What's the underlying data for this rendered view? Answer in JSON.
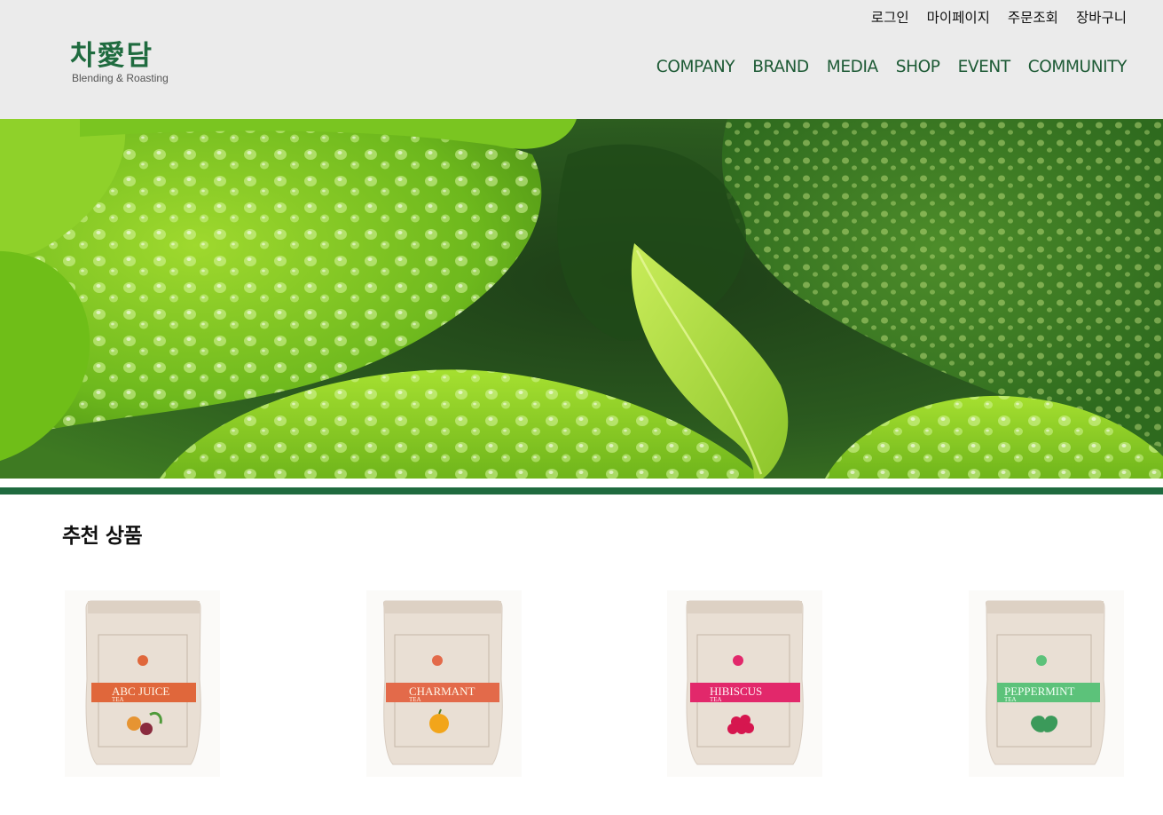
{
  "header": {
    "logo": {
      "mark": "차愛담",
      "sub": "Blending & Roasting"
    },
    "util_nav": [
      "로그인",
      "마이페이지",
      "주문조회",
      "장바구니"
    ],
    "main_nav": [
      "COMPANY",
      "BRAND",
      "MEDIA",
      "SHOP",
      "EVENT",
      "COMMUNITY"
    ]
  },
  "hero": {
    "image": "green-leaves-with-water-droplets"
  },
  "section": {
    "title": "추천 상품"
  },
  "products": [
    {
      "name": "ABC JUICE",
      "sub": "TEA",
      "accent": "#e0673b",
      "illustration": "vegetables"
    },
    {
      "name": "CHARMANT",
      "sub": "TEA",
      "accent": "#e36a4a",
      "illustration": "orange-fruit"
    },
    {
      "name": "HIBISCUS",
      "sub": "TEA",
      "accent": "#e2286b",
      "illustration": "hibiscus-flower"
    },
    {
      "name": "PEPPERMINT",
      "sub": "TEA",
      "accent": "#5cc27a",
      "illustration": "mint-leaves"
    }
  ],
  "colors": {
    "brand_green": "#1f6b3f",
    "nav_green": "#1d5a35",
    "header_bg": "#ebebeb"
  }
}
